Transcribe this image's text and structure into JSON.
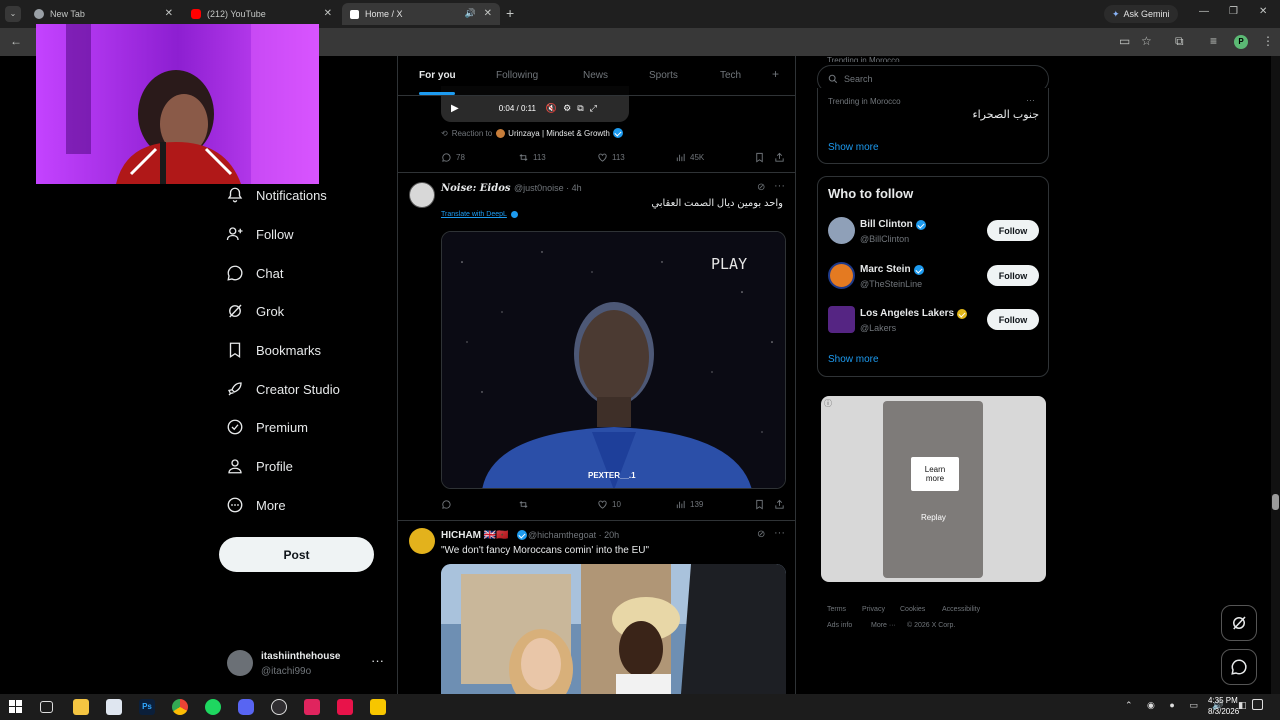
{
  "browser": {
    "tabs": [
      {
        "label": "New Tab"
      },
      {
        "label": "(212) YouTube"
      },
      {
        "label": "Home / X"
      }
    ],
    "ask_gemini": "Ask Gemini",
    "profile_initial": "P"
  },
  "sidebar": {
    "items": [
      {
        "label": "Notifications",
        "icon": "bell-icon"
      },
      {
        "label": "Follow",
        "icon": "person-add-icon"
      },
      {
        "label": "Chat",
        "icon": "chat-icon"
      },
      {
        "label": "Grok",
        "icon": "grok-icon"
      },
      {
        "label": "Bookmarks",
        "icon": "bookmark-icon"
      },
      {
        "label": "Creator Studio",
        "icon": "rocket-icon"
      },
      {
        "label": "Premium",
        "icon": "verified-icon"
      },
      {
        "label": "Profile",
        "icon": "person-icon"
      },
      {
        "label": "More",
        "icon": "more-circle-icon"
      }
    ],
    "post_label": "Post",
    "account": {
      "name": "itashiinthehouse",
      "handle": "@itachi99o"
    }
  },
  "feed": {
    "tabs": [
      "For you",
      "Following",
      "News",
      "Sports",
      "Tech"
    ],
    "video_time": "0:04 / 0:11",
    "reaction_prefix": "Reaction to",
    "reaction_account": "Urinzaya | Mindset & Growth",
    "tweet1_stats": {
      "replies": "78",
      "reposts": "113",
      "likes": "113",
      "views": "45K"
    },
    "tweet2": {
      "name": "𝑵𝒐𝒊𝒔𝒆: 𝑬𝒊𝒅𝒐𝒔",
      "handle_time": "@just0noise · 4h",
      "text": "واحد بومين ديال الصمت العقابي",
      "translate": "Translate with DeepL",
      "video_overlay": "PLAY",
      "video_caption": "PEXTER__.1",
      "stats": {
        "likes": "10",
        "views": "139"
      }
    },
    "tweet3": {
      "name": "HICHAM 🇬🇧🇲🇦",
      "handle_time": "@hichamthegoat · 20h",
      "text": "\"We don't fancy Moroccans comin' into the EU\""
    }
  },
  "right": {
    "search_placeholder": "Search",
    "trending_top": "Trending in Morocco",
    "trend_context": "Trending in Morocco",
    "trend_topic": "جنوب الصحراء",
    "show_more": "Show more",
    "who_to_follow": "Who to follow",
    "follow": [
      {
        "name": "Bill Clinton",
        "handle": "@BillClinton",
        "button": "Follow",
        "badge": "#1d9bf0"
      },
      {
        "name": "Marc Stein",
        "handle": "@TheSteinLine",
        "button": "Follow",
        "badge": "#1d9bf0"
      },
      {
        "name": "Los Angeles Lakers",
        "handle": "@Lakers",
        "button": "Follow",
        "badge": "#e2b719"
      }
    ],
    "ad": {
      "learn_more": "Learn more",
      "replay": "Replay"
    },
    "footer": [
      "Terms",
      "Privacy",
      "Cookies",
      "Accessibility",
      "Ads info",
      "More ···",
      "© 2026 X Corp."
    ]
  },
  "taskbar": {
    "time": "4:35 PM",
    "date": "8/3/2026"
  }
}
